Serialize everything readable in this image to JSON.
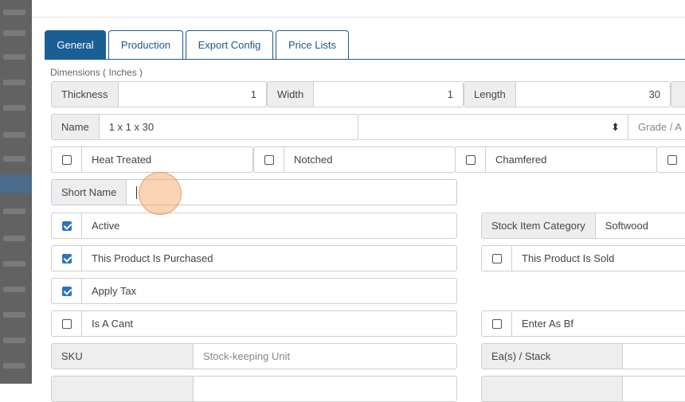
{
  "tabs": [
    "General",
    "Production",
    "Export Config",
    "Price Lists"
  ],
  "dimensions_label": "Dimensions ( Inches )",
  "thickness": {
    "label": "Thickness",
    "value": "1"
  },
  "width": {
    "label": "Width",
    "value": "1"
  },
  "length": {
    "label": "Length",
    "value": "30"
  },
  "name": {
    "label": "Name",
    "value": "1 x 1 x 30",
    "select_icon": "updown-arrows-icon"
  },
  "grade": {
    "label": "Grade / A"
  },
  "flags": [
    {
      "label": "Heat Treated",
      "checked": false
    },
    {
      "label": "Notched",
      "checked": false
    },
    {
      "label": "Chamfered",
      "checked": false
    }
  ],
  "short_name": {
    "label": "Short Name",
    "value": ""
  },
  "active": {
    "label": "Active",
    "checked": true
  },
  "stock_item_category": {
    "label": "Stock Item Category",
    "value": "Softwood"
  },
  "purchased": {
    "label": "This Product Is Purchased",
    "checked": true
  },
  "sold": {
    "label": "This Product Is Sold",
    "checked": false
  },
  "apply_tax": {
    "label": "Apply Tax",
    "checked": true
  },
  "is_a_cant": {
    "label": "Is A Cant",
    "checked": false
  },
  "enter_as_bf": {
    "label": "Enter As Bf",
    "checked": false
  },
  "sku": {
    "label": "SKU",
    "placeholder": "Stock-keeping Unit"
  },
  "ea_stack": {
    "label": "Ea(s) / Stack"
  },
  "colors": {
    "accent": "#1a5f94",
    "checkbox": "#2a73c8",
    "addon_bg": "#eeeeee"
  }
}
